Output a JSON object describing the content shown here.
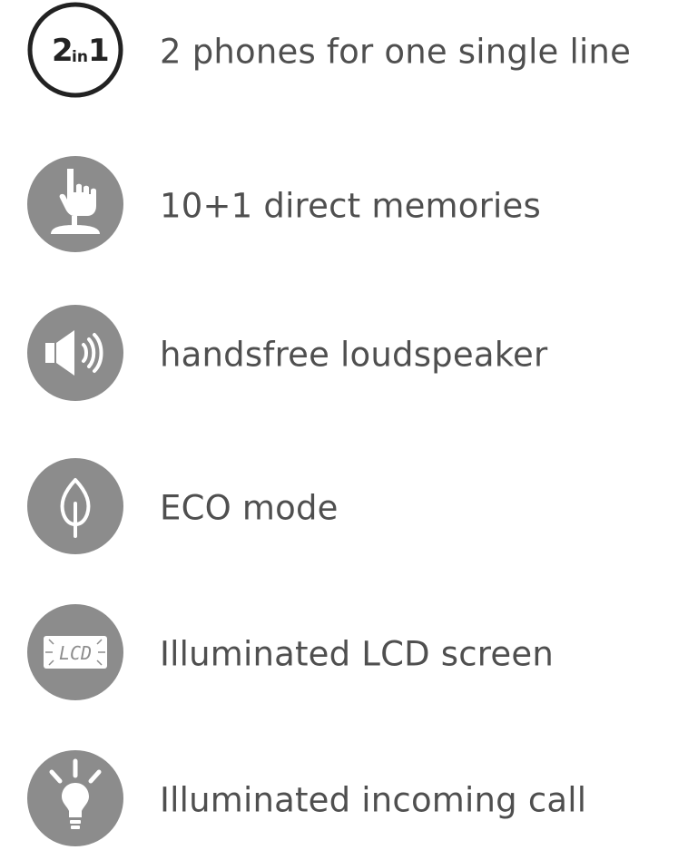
{
  "features": [
    {
      "icon": "two-in-one-icon",
      "icon_text_main": "2",
      "icon_text_mid": "in",
      "icon_text_end": "1",
      "label": "2 phones for one single line"
    },
    {
      "icon": "finger-press-icon",
      "label": "10+1 direct memories"
    },
    {
      "icon": "speaker-icon",
      "label": "handsfree loudspeaker"
    },
    {
      "icon": "leaf-icon",
      "label": "ECO mode"
    },
    {
      "icon": "lcd-screen-icon",
      "icon_text": "LCD",
      "label": "Illuminated LCD screen"
    },
    {
      "icon": "light-bulb-icon",
      "label": "Illuminated incoming call"
    }
  ],
  "colors": {
    "icon_bg": "#8c8c8c",
    "icon_fg": "#ffffff",
    "outline": "#222222",
    "text": "#4f4f4f"
  }
}
